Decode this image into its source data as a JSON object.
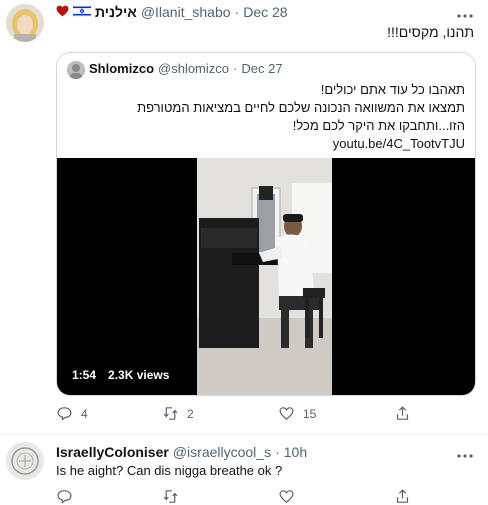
{
  "tweet": {
    "display_name": "אילנית",
    "handle": "@Ilanit_shabo",
    "separator": "·",
    "date": "Dec 28",
    "text": "תהנו, מקסים!!!",
    "flag_icon": "israel-flag-icon",
    "heart_icon": "heart-icon"
  },
  "quote": {
    "display_name": "Shlomizco",
    "handle": "@shlomizco",
    "separator": "·",
    "date": "Dec 27",
    "lines": [
      "תאהבו כל עוד אתם יכולים!",
      "תמצאו את המשוואה הנכונה שלכם לחיים במציאות המטורפת",
      "הזו...ותחבקו את היקר לכם מכל!",
      "youtu.be/4C_TootvTJU"
    ],
    "video": {
      "duration": "1:54",
      "views": "2.3K views"
    }
  },
  "actions": {
    "reply_count": "4",
    "retweet_count": "2",
    "like_count": "15"
  },
  "reply": {
    "display_name": "IsraellyColoniser",
    "handle": "@israellycool_s",
    "separator": "·",
    "time": "10h",
    "text": "Is he aight? Can dis nigga breathe ok ?"
  },
  "colors": {
    "text": "#0f1419",
    "secondary": "#536471",
    "border": "#cfd9de",
    "heart": "#b31217",
    "flag_blue": "#0038b8"
  }
}
